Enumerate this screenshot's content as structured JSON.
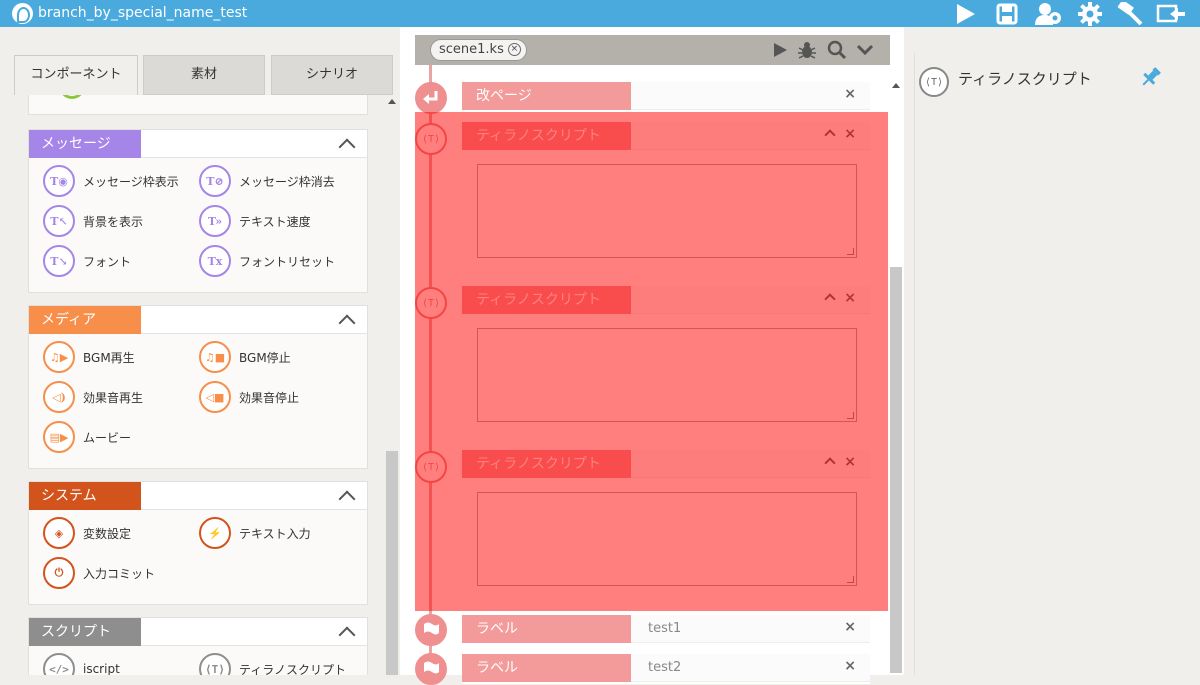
{
  "app": {
    "title": "branch_by_special_name_test"
  },
  "titlebar_icons": [
    "play-icon",
    "save-icon",
    "users-icon",
    "settings-icon",
    "build-icon",
    "exit-icon"
  ],
  "left_tabs": [
    {
      "label": "コンポーネント",
      "active": true
    },
    {
      "label": "素材",
      "active": false
    },
    {
      "label": "シナリオ",
      "active": false
    }
  ],
  "groups": [
    {
      "name": "メッセージ",
      "color": "#a685e8",
      "items": [
        "メッセージ枠表示",
        "メッセージ枠消去",
        "背景を表示",
        "テキスト速度",
        "フォント",
        "フォントリセット"
      ]
    },
    {
      "name": "メディア",
      "color": "#f78e4a",
      "items": [
        "BGM再生",
        "BGM停止",
        "効果音再生",
        "効果音停止",
        "ムービー"
      ]
    },
    {
      "name": "システム",
      "color": "#d2541c",
      "items": [
        "変数設定",
        "テキスト入力",
        "入力コミット"
      ]
    },
    {
      "name": "スクリプト",
      "color": "#8e8e8e",
      "items": [
        "iscript",
        "ティラノスクリプト"
      ]
    }
  ],
  "editor": {
    "file_tab": "scene1.ks",
    "blocks": [
      {
        "name": "改ページ",
        "value": ""
      },
      {
        "name": "ティラノスクリプト",
        "value": ""
      },
      {
        "name": "ティラノスクリプト",
        "value": ""
      },
      {
        "name": "ティラノスクリプト",
        "value": ""
      },
      {
        "name": "ラベル",
        "value": "test1"
      },
      {
        "name": "ラベル",
        "value": "test2"
      }
    ],
    "highlight_color": "#ff0000"
  },
  "right_panel": {
    "title": "ティラノスクリプト",
    "icon_text": "⟨T⟩"
  },
  "colors": {
    "titlebar": "#4aa9dd",
    "block_header": "#f39a9a",
    "pin": "#4aa9dd"
  }
}
